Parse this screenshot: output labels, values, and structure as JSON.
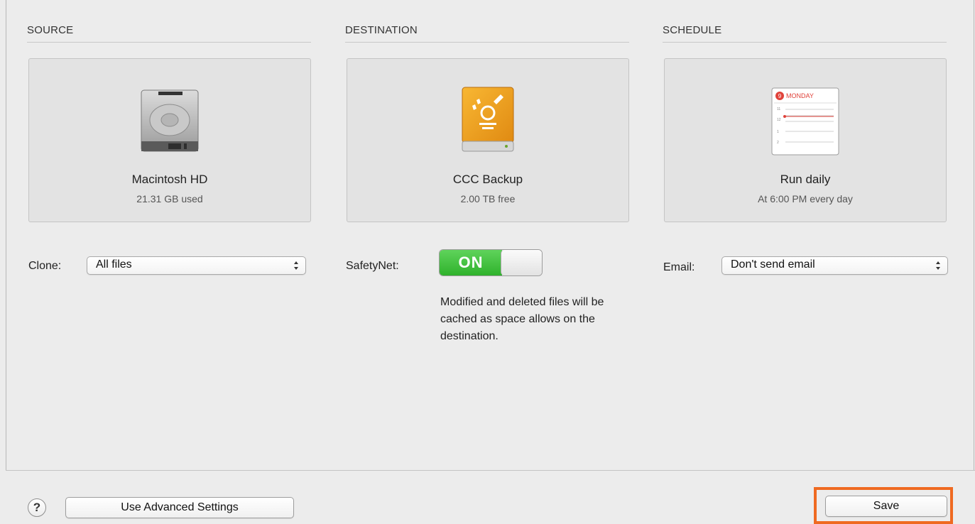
{
  "source": {
    "title": "SOURCE",
    "name": "Macintosh HD",
    "detail": "21.31 GB used",
    "icon": "hard-drive-icon",
    "clone_label": "Clone:",
    "clone_value": "All files"
  },
  "destination": {
    "title": "DESTINATION",
    "name": "CCC Backup",
    "detail": "2.00 TB free",
    "icon": "firewire-drive-icon",
    "safetynet_label": "SafetyNet:",
    "safetynet_state": "ON",
    "safetynet_description": "Modified and deleted files will be cached as space allows on the destination."
  },
  "schedule": {
    "title": "SCHEDULE",
    "name": "Run daily",
    "detail": "At 6:00 PM every day",
    "icon": "calendar-icon",
    "calendar_day": "MONDAY",
    "calendar_date": "9",
    "calendar_hours": [
      "11",
      "12",
      "1",
      "2"
    ],
    "email_label": "Email:",
    "email_value": "Don't send email"
  },
  "footer": {
    "help_label": "?",
    "advanced_label": "Use Advanced Settings",
    "save_label": "Save"
  },
  "colors": {
    "accent_highlight": "#ef6a21",
    "toggle_on": "#3cc03a",
    "drive_orange": "#f0a020"
  }
}
